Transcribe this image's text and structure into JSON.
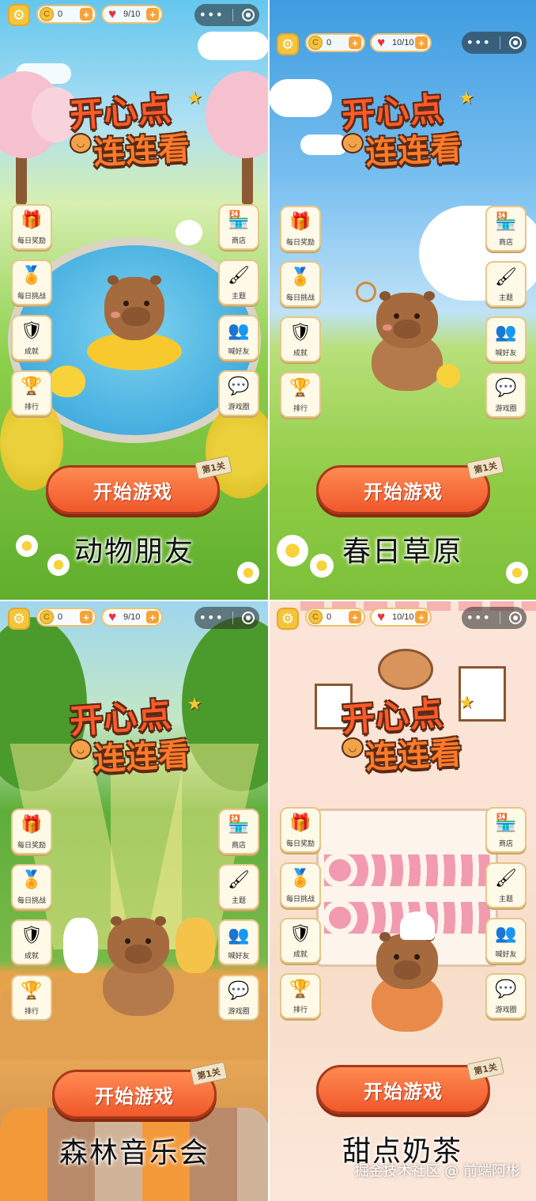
{
  "panels": [
    {
      "coins": "0",
      "lives": "9/10",
      "logo_line1": "开心点",
      "logo_line2": "连连看",
      "left_buttons": [
        "每日奖励",
        "每日挑战",
        "成就",
        "排行"
      ],
      "right_buttons": [
        "商店",
        "主题",
        "喊好友",
        "游戏圈"
      ],
      "start_label": "开始游戏",
      "level_tag": "第1关",
      "caption": "动物朋友"
    },
    {
      "coins": "0",
      "lives": "10/10",
      "logo_line1": "开心点",
      "logo_line2": "连连看",
      "left_buttons": [
        "每日奖励",
        "每日挑战",
        "成就",
        "排行"
      ],
      "right_buttons": [
        "商店",
        "主题",
        "喊好友",
        "游戏圈"
      ],
      "start_label": "开始游戏",
      "level_tag": "第1关",
      "caption": "春日草原"
    },
    {
      "coins": "0",
      "lives": "9/10",
      "logo_line1": "开心点",
      "logo_line2": "连连看",
      "left_buttons": [
        "每日奖励",
        "每日挑战",
        "成就",
        "排行"
      ],
      "right_buttons": [
        "商店",
        "主题",
        "喊好友",
        "游戏圈"
      ],
      "start_label": "开始游戏",
      "level_tag": "第1关",
      "caption": "森林音乐会"
    },
    {
      "coins": "0",
      "lives": "10/10",
      "logo_line1": "开心点",
      "logo_line2": "连连看",
      "left_buttons": [
        "每日奖励",
        "每日挑战",
        "成就",
        "排行"
      ],
      "right_buttons": [
        "商店",
        "主题",
        "喊好友",
        "游戏圈"
      ],
      "start_label": "开始游戏",
      "level_tag": "第1关",
      "caption": "甜点奶茶"
    }
  ],
  "icons": {
    "settings": "gear-icon",
    "coin": "coin-icon",
    "heart": "heart-icon",
    "plus": "plus-icon",
    "more": "more-dots-icon",
    "close": "target-icon",
    "left": [
      "gift-icon",
      "medal-icon",
      "trophy-shield-icon",
      "podium-icon"
    ],
    "right": [
      "shop-icon",
      "paintbrush-icon",
      "friends-icon",
      "chat-bubbles-icon"
    ]
  },
  "colors": {
    "start_button": "#f0582a",
    "logo_text": "#ff5a2a",
    "button_bg": "#fff9e8",
    "accent_gold": "#f5c33b"
  },
  "watermark": "掘金技术社区 @ 前端阿彬"
}
